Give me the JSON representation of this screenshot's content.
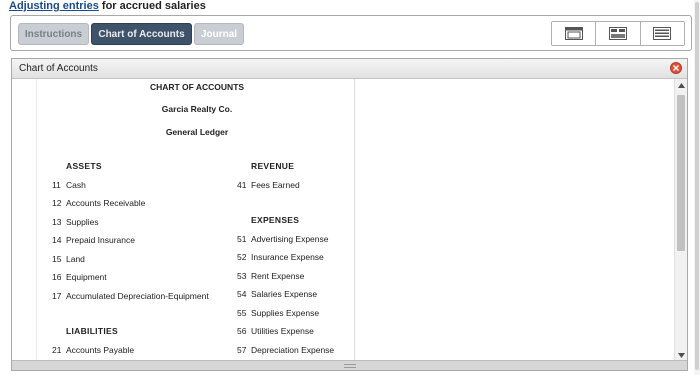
{
  "header": {
    "link_text": "Adjusting entries",
    "rest_text": " for accrued salaries"
  },
  "tabs": [
    {
      "label": "Instructions"
    },
    {
      "label": "Chart of Accounts"
    },
    {
      "label": "Journal"
    }
  ],
  "view_buttons": [
    "single-pane-view-icon",
    "split-pane-view-icon",
    "list-view-icon"
  ],
  "panel": {
    "title": "Chart of Accounts"
  },
  "chart": {
    "title": "CHART OF ACCOUNTS",
    "company": "Garcia Realty Co.",
    "ledger": "General Ledger",
    "left_sections": [
      {
        "heading": "ASSETS",
        "accounts": [
          {
            "no": "11",
            "name": "Cash"
          },
          {
            "no": "12",
            "name": "Accounts Receivable"
          },
          {
            "no": "13",
            "name": "Supplies"
          },
          {
            "no": "14",
            "name": "Prepaid Insurance"
          },
          {
            "no": "15",
            "name": "Land"
          },
          {
            "no": "16",
            "name": "Equipment"
          },
          {
            "no": "17",
            "name": "Accumulated Depreciation-Equipment"
          }
        ]
      },
      {
        "heading": "LIABILITIES",
        "accounts": [
          {
            "no": "21",
            "name": "Accounts Payable"
          }
        ]
      }
    ],
    "right_sections": [
      {
        "heading": "REVENUE",
        "accounts": [
          {
            "no": "41",
            "name": "Fees Earned"
          }
        ]
      },
      {
        "heading": "EXPENSES",
        "accounts": [
          {
            "no": "51",
            "name": "Advertising Expense"
          },
          {
            "no": "52",
            "name": "Insurance Expense"
          },
          {
            "no": "53",
            "name": "Rent Expense"
          },
          {
            "no": "54",
            "name": "Salaries Expense"
          },
          {
            "no": "55",
            "name": "Supplies Expense"
          },
          {
            "no": "56",
            "name": "Utilities Expense"
          },
          {
            "no": "57",
            "name": "Depreciation Expense"
          }
        ]
      }
    ]
  },
  "colors": {
    "active_tab": "#3e5269",
    "inactive_tab": "#c9ced4",
    "link": "#1a4b8c",
    "close": "#e0523c"
  }
}
